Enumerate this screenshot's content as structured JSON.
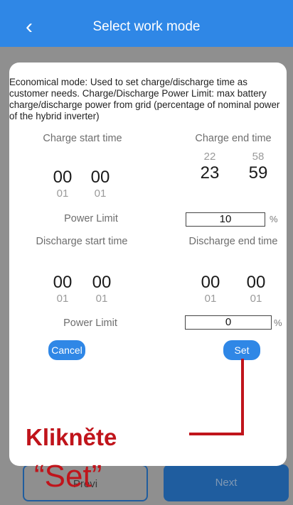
{
  "header": {
    "back_glyph": "‹",
    "title": "Select work mode"
  },
  "dialog": {
    "description": "Economical mode: Used to set charge/discharge time as customer needs. Charge/Discharge Power Limit: max battery charge/discharge power from grid (percentage of nominal power of the hybrid inverter)",
    "charge": {
      "start_label": "Charge start time",
      "end_label": "Charge end time",
      "start_hour": "00",
      "start_min": "00",
      "start_hour_next": "01",
      "start_min_next": "01",
      "end_hour_prev": "22",
      "end_min_prev": "58",
      "end_hour": "23",
      "end_min": "59",
      "power_label": "Power Limit",
      "power_value": "10",
      "unit": "%"
    },
    "discharge": {
      "start_label": "Discharge start time",
      "end_label": "Discharge end time",
      "start_hour": "00",
      "start_min": "00",
      "start_hour_next": "01",
      "start_min_next": "01",
      "end_hour": "00",
      "end_min": "00",
      "end_hour_next": "01",
      "end_min_next": "01",
      "power_label": "Power Limit",
      "power_value": "0",
      "unit": "%"
    },
    "cancel_label": "Cancel",
    "set_label": "Set"
  },
  "bottom": {
    "prev_label": "Previ",
    "next_label": "Next"
  },
  "annotation": {
    "line1": "Klikněte",
    "line2": "“Set”"
  },
  "colors": {
    "accent": "#2f87e6",
    "callout": "#c0141b"
  }
}
